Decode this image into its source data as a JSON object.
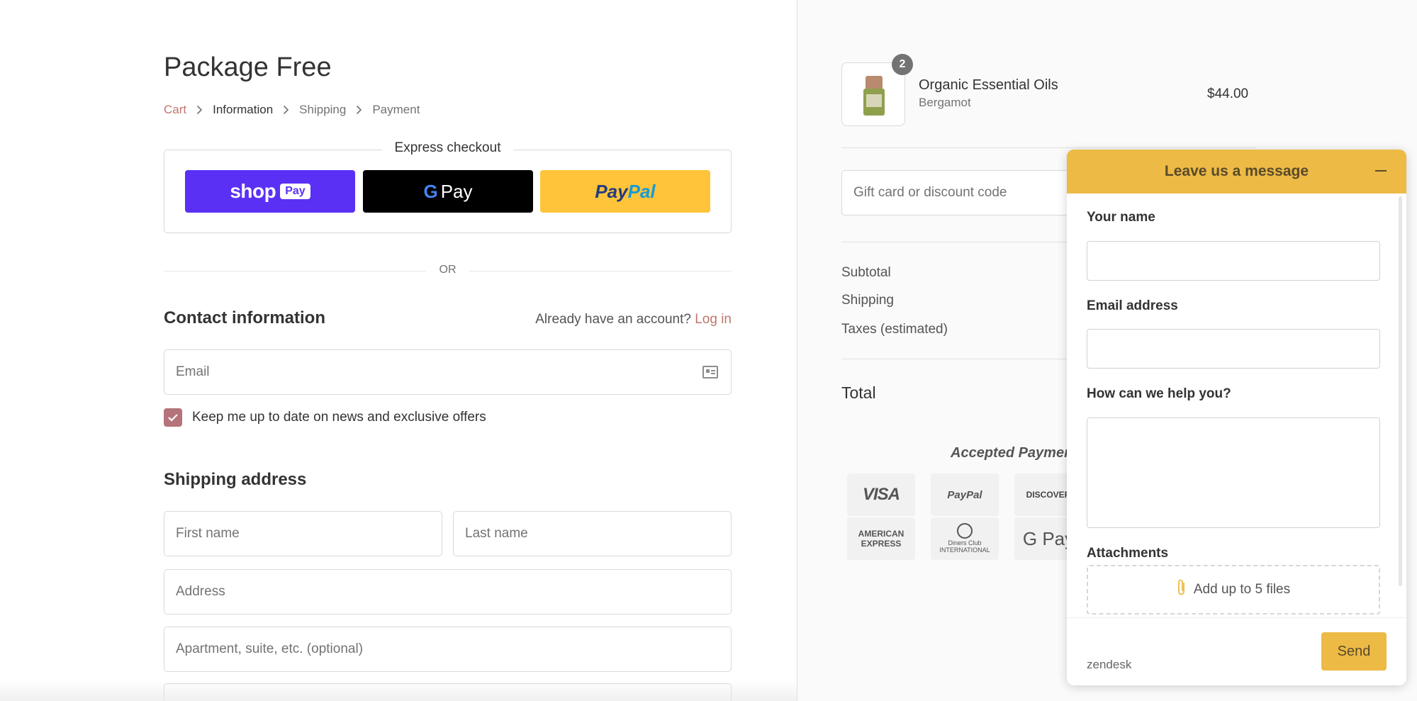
{
  "shop": {
    "title": "Package Free"
  },
  "breadcrumb": [
    {
      "label": "Cart"
    },
    {
      "label": "Information"
    },
    {
      "label": "Shipping"
    },
    {
      "label": "Payment"
    }
  ],
  "express": {
    "title": "Express checkout",
    "shop_pay": {
      "word": "shop",
      "pill": "Pay"
    },
    "google_pay": {
      "g": "G",
      "word": "Pay"
    },
    "paypal": {
      "p1": "Pay",
      "p2": "Pal"
    }
  },
  "divider_or": "OR",
  "contact": {
    "heading": "Contact information",
    "account_prompt": "Already have an account?",
    "login_label": "Log in",
    "email_placeholder": "Email",
    "newsletter_label": "Keep me up to date on news and exclusive offers",
    "newsletter_checked": true
  },
  "shipping": {
    "heading": "Shipping address",
    "first_name_placeholder": "First name",
    "last_name_placeholder": "Last name",
    "address_placeholder": "Address",
    "apartment_placeholder": "Apartment, suite, etc. (optional)"
  },
  "order": {
    "product_name": "Organic Essential Oils",
    "product_variant": "Bergamot",
    "product_price": "$44.00",
    "quantity": "2",
    "discount_placeholder": "Gift card or discount code",
    "subtotal_label": "Subtotal",
    "shipping_label": "Shipping",
    "taxes_label": "Taxes (estimated)",
    "total_label": "Total",
    "accepted_label": "Accepted Paymen",
    "payment_methods": {
      "visa": "VISA",
      "paypal": "PayPal",
      "discover": "DISCOVER",
      "amex_1": "AMERICAN",
      "amex_2": "EXPRESS",
      "diners_1": "Diners Club",
      "diners_2": "INTERNATIONAL",
      "gpay": "G Pay"
    }
  },
  "widget": {
    "title": "Leave us a message",
    "name_label": "Your name",
    "email_label": "Email address",
    "help_label": "How can we help you?",
    "attachments_label": "Attachments",
    "attach_text": "Add up to 5 files",
    "brand": "zendesk",
    "send_label": "Send",
    "accent_color": "#ecba45"
  }
}
